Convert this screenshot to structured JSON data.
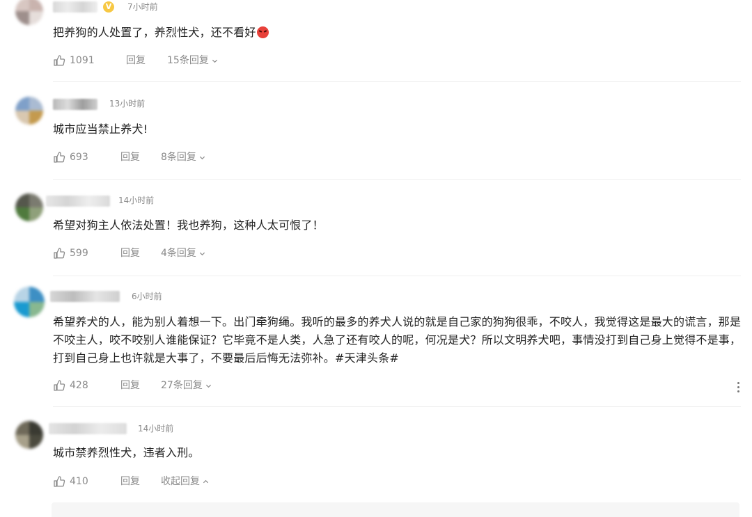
{
  "comments": [
    {
      "time": "7小时前",
      "text": "把养狗的人处置了，养烈性犬，还不看好",
      "emoji": "angry-face",
      "likes": "1091",
      "reply_label": "回复",
      "replies_label": "15条回复",
      "verified": true
    },
    {
      "time": "13小时前",
      "text": "城市应当禁止养犬!",
      "likes": "693",
      "reply_label": "回复",
      "replies_label": "8条回复"
    },
    {
      "time": "14小时前",
      "text": "希望对狗主人依法处置！我也养狗，这种人太可恨了！",
      "likes": "599",
      "reply_label": "回复",
      "replies_label": "4条回复"
    },
    {
      "time": "6小时前",
      "text": "希望养犬的人，能为别人着想一下。出门牵狗绳。我听的最多的养犬人说的就是自己家的狗狗很乖，不咬人，我觉得这是最大的谎言，那是不咬主人，咬不咬别人谁能保证？它毕竟不是人类，人急了还有咬人的呢，何况是犬？所以文明养犬吧，事情没打到自己身上觉得不是事，打到自己身上也许就是大事了，不要最后后悔无法弥补。#天津头条#",
      "likes": "428",
      "reply_label": "回复",
      "replies_label": "27条回复"
    },
    {
      "time": "14小时前",
      "text": "城市禁养烈性犬，违者入刑。",
      "likes": "410",
      "reply_label": "回复",
      "replies_label": "收起回复"
    }
  ],
  "icons": {
    "like": "thumbs-up-icon",
    "expand": "chevron-down-icon",
    "collapse": "chevron-up-icon",
    "more": "more-vertical-icon",
    "verified": "verified-v-badge"
  },
  "colors": {
    "muted_text": "#8a8a8a",
    "body_text": "#222222",
    "divider": "#eeeeee",
    "verified_badge": "#f7c844"
  }
}
